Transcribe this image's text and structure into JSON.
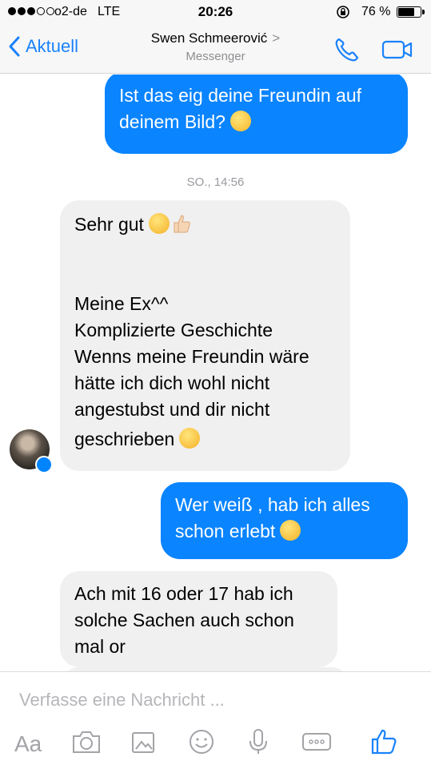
{
  "status_bar": {
    "carrier": "o2-de",
    "network": "LTE",
    "time": "20:26",
    "battery": "76 %",
    "battery_level": 0.76
  },
  "nav": {
    "back_label": "Aktuell",
    "contact_name": "Swen Schmeerović",
    "chevron": ">",
    "subtitle": "Messenger"
  },
  "messages": {
    "m1": {
      "lines": [
        "Ist das eig deine Freundin auf",
        "deinem Bild?"
      ]
    },
    "timestamp": "SO., 14:56",
    "m2": {
      "lines": [
        "Sehr gut",
        "Meine Ex^^",
        "Komplizierte Geschichte",
        "Wenns meine Freundin wäre",
        "hätte ich dich wohl nicht",
        "angestubst und dir nicht",
        "geschrieben"
      ]
    },
    "m3": {
      "lines": [
        "Wer weiß , hab ich alles",
        "schon erlebt"
      ]
    },
    "m4": {
      "lines": [
        "Ach mit 16 oder 17 hab ich",
        "solche Sachen auch schon",
        "mal or"
      ]
    }
  },
  "composer": {
    "placeholder": "Verfasse eine Nachricht ...",
    "tools": {
      "text_label": "Aa"
    }
  },
  "colors": {
    "accent": "#1a82fb",
    "sent_bubble": "#0a84ff",
    "received_bubble": "#f1f0f0"
  }
}
